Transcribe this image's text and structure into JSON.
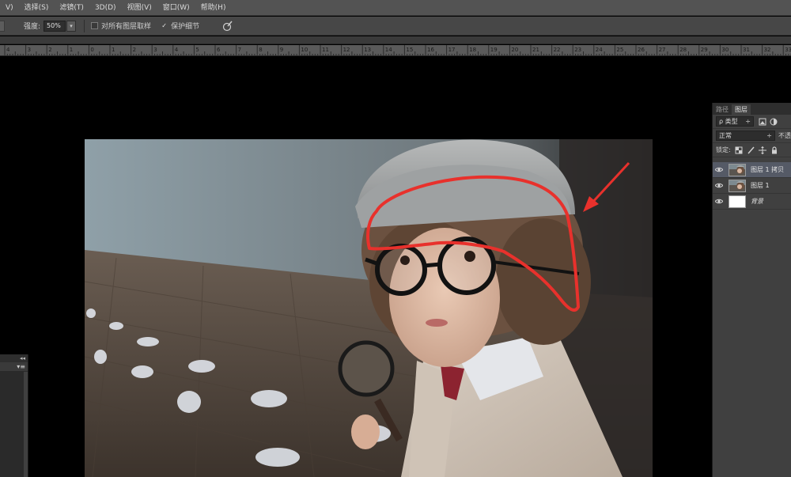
{
  "menu": [
    {
      "name": "menu-image",
      "label": "V)"
    },
    {
      "name": "menu-select",
      "label": "选择(S)"
    },
    {
      "name": "menu-filter",
      "label": "滤镜(T)"
    },
    {
      "name": "menu-3d",
      "label": "3D(D)"
    },
    {
      "name": "menu-view",
      "label": "视图(V)"
    },
    {
      "name": "menu-window",
      "label": "窗口(W)"
    },
    {
      "name": "menu-help",
      "label": "帮助(H)"
    }
  ],
  "options": {
    "strength_label": "强度:",
    "strength_value": "50%",
    "strength_dropdown": "▾",
    "sample_all_layers_label": "对所有图层取样",
    "sample_all_layers_checked": false,
    "protect_detail_label": "保护细节",
    "protect_detail_checked": true,
    "check_mark": "✓"
  },
  "ruler": {
    "ticks": [
      "4",
      "3",
      "2",
      "1",
      "0",
      "1",
      "2",
      "3",
      "4",
      "5",
      "6",
      "7",
      "8",
      "9",
      "10",
      "11",
      "12",
      "13",
      "14",
      "15",
      "16",
      "17",
      "18",
      "19",
      "20",
      "21",
      "22",
      "23",
      "24",
      "25",
      "26",
      "27",
      "28",
      "29",
      "30",
      "31",
      "32",
      "33"
    ]
  },
  "layers_panel": {
    "tabs": [
      {
        "label": "路径",
        "active": false
      },
      {
        "label": "图层",
        "active": true
      }
    ],
    "filter_label": "ρ 类型",
    "filter_arrow": "÷",
    "blend_mode": "正常",
    "blend_arrow": "÷",
    "opacity_label": "不透",
    "lock_label": "锁定:",
    "layers": [
      {
        "name": "图层 1 拷贝",
        "visible": true,
        "selected": true,
        "thumb": "photo",
        "italic": false
      },
      {
        "name": "图层 1",
        "visible": true,
        "selected": false,
        "thumb": "photo",
        "italic": false
      },
      {
        "name": "背景",
        "visible": true,
        "selected": false,
        "thumb": "white",
        "italic": true
      }
    ]
  },
  "left_panel": {
    "collapse": "◂◂",
    "menu": "▾≡"
  },
  "colors": {
    "annotation_red": "#e8312c",
    "menubar": "#535353",
    "panel": "#404040",
    "selected_layer": "#555a66"
  }
}
